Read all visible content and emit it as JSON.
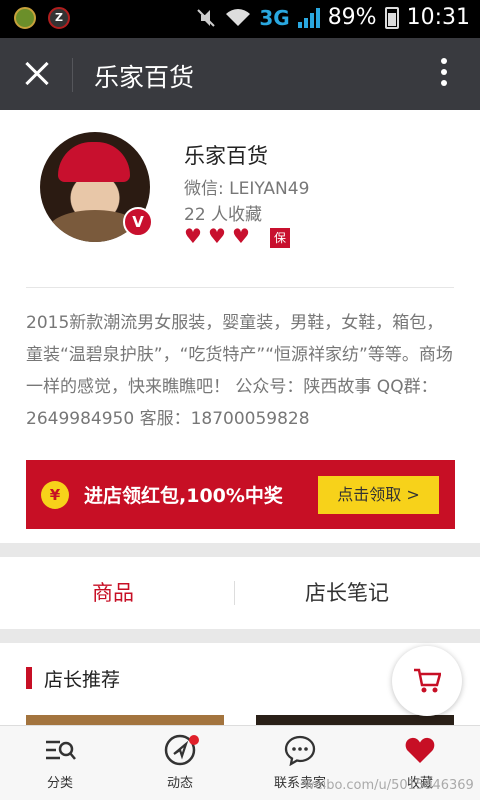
{
  "status_bar": {
    "network": "3G",
    "battery": "89%",
    "time": "10:31"
  },
  "title_bar": {
    "title": "乐家百货"
  },
  "profile": {
    "name": "乐家百货",
    "wechat": "微信: LEIYAN49",
    "favorites": "22 人收藏",
    "verified_badge": "V",
    "guarantee_badge": "保",
    "rating_hearts": 3
  },
  "description": "2015新款潮流男女服装，婴童装，男鞋，女鞋，箱包，童装“温碧泉护肤”，“吃货特产”“恒源祥家纺”等等。商场一样的感觉，快来瞧瞧吧！ 公众号：陕西故事 QQ群：2649984950 客服：18700059828",
  "promo": {
    "currency_icon": "¥",
    "text": "进店领红包,100%中奖",
    "button": "点击领取 >"
  },
  "tabs": [
    {
      "label": "商品",
      "active": true
    },
    {
      "label": "店长笔记",
      "active": false
    }
  ],
  "recommend": {
    "title": "店长推荐"
  },
  "bottom_nav": [
    {
      "label": "分类",
      "icon": "category-icon"
    },
    {
      "label": "动态",
      "icon": "compass-icon"
    },
    {
      "label": "联系卖家",
      "icon": "chat-icon"
    },
    {
      "label": "收藏",
      "icon": "heart-icon"
    }
  ],
  "watermark": "weibo.com/u/5015946369",
  "colors": {
    "accent": "#c70f25",
    "promo_button": "#f7d21a",
    "title_bar": "#393a3f"
  }
}
